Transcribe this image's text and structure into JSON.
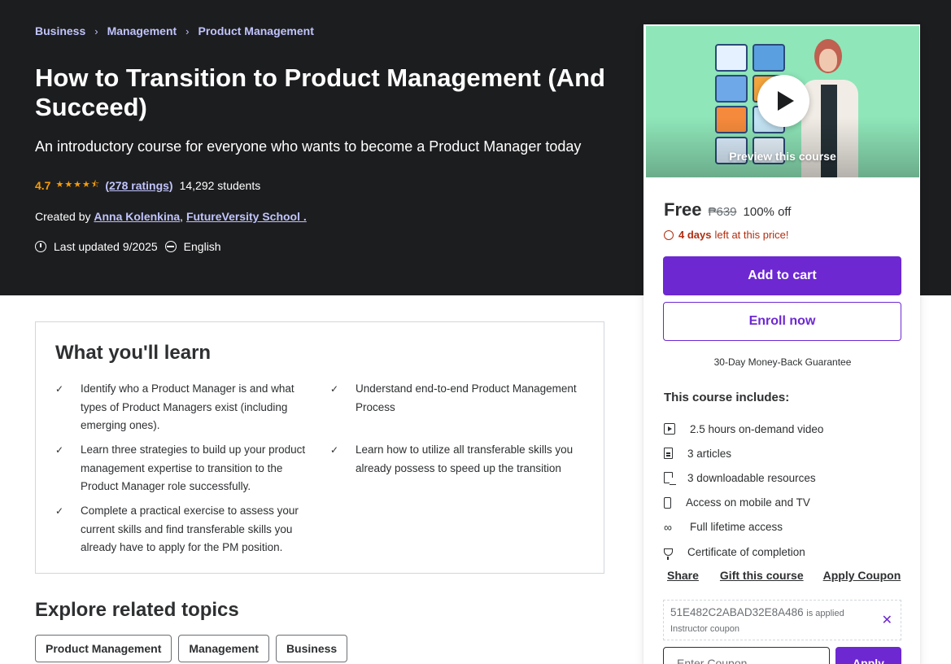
{
  "breadcrumb": [
    "Business",
    "Management",
    "Product Management"
  ],
  "course": {
    "title": "How to Transition to Product Management (And Succeed)",
    "headline": "An introductory course for everyone who wants to become a Product Manager today",
    "rating": "4.7",
    "stars": "★★★★⯪",
    "ratings_count": "(278 ratings)",
    "students": "14,292 students",
    "created_by_label": "Created by",
    "instructor_1": "Anna Kolenkina",
    "instructor_sep": ",",
    "instructor_2": "FutureVersity School .",
    "last_updated": "Last updated 9/2025",
    "language": "English"
  },
  "sidebar": {
    "preview_label": "Preview this course",
    "price": "Free",
    "original_price": "₱639",
    "discount": "100% off",
    "countdown_bold": "4 days",
    "countdown_rest": "left at this price!",
    "add_to_cart": "Add to cart",
    "enroll_now": "Enroll now",
    "guarantee": "30-Day Money-Back Guarantee",
    "includes_title": "This course includes:",
    "includes": [
      {
        "icon": "video-icon",
        "label": "2.5 hours on-demand video"
      },
      {
        "icon": "article-icon",
        "label": "3 articles"
      },
      {
        "icon": "download-icon",
        "label": "3 downloadable resources"
      },
      {
        "icon": "mobile-icon",
        "label": "Access on mobile and TV"
      },
      {
        "icon": "infinity-icon",
        "label": "Full lifetime access"
      },
      {
        "icon": "trophy-icon",
        "label": "Certificate of completion"
      }
    ],
    "share": "Share",
    "gift": "Gift this course",
    "apply_coupon": "Apply Coupon",
    "coupon_code": "51E482C2ABAD32E8A486",
    "coupon_applied": "is applied",
    "coupon_type": "Instructor coupon",
    "coupon_placeholder": "Enter Coupon",
    "apply_button": "Apply"
  },
  "learn": {
    "title": "What you'll learn",
    "items": [
      "Identify who a Product Manager is and what types of Product Managers exist (including emerging ones).",
      "Understand end-to-end Product Management Process",
      "Learn three strategies to build up your product management expertise to transition to the Product Manager role successfully.",
      "Learn how to utilize all transferable skills you already possess to speed up the transition",
      "Complete a practical exercise to assess your current skills and find transferable skills you already have to apply for the PM position."
    ]
  },
  "explore": {
    "title": "Explore related topics",
    "topics": [
      "Product Management",
      "Management",
      "Business"
    ]
  },
  "colors": {
    "hero_bg": "#1c1d1f",
    "accent": "#6d28d2",
    "star": "#f69c08",
    "link_light": "#c0c4fc",
    "alert": "#b32d0f"
  }
}
